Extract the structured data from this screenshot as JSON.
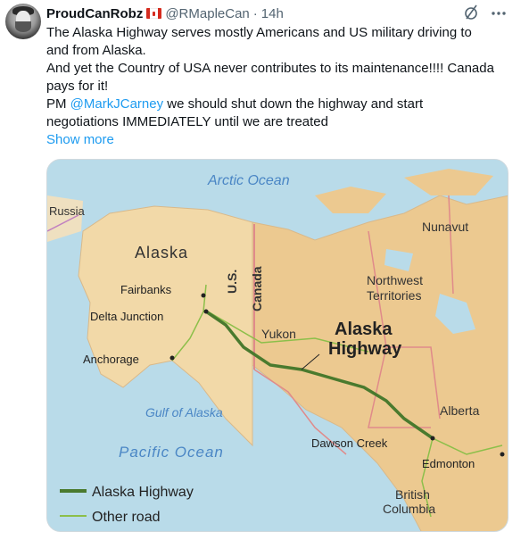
{
  "author": {
    "display_name": "ProudCanRobz",
    "handle": "@RMapleCan",
    "separator": "·",
    "timestamp": "14h"
  },
  "icons": {
    "avatar": "avatar-photo",
    "flag": "canada-flag-emoji",
    "grok": "grok-icon",
    "more": "more-options-icon"
  },
  "tweet": {
    "lines": [
      "The Alaska Highway serves mostly Americans and US military driving to",
      "and from Alaska.",
      "And yet the Country of USA never contributes to its maintenance!!!! Canada",
      "pays for it!"
    ],
    "pm_prefix": "PM ",
    "mention": "@MarkJCarney",
    "pm_suffix": " we should shut down the highway and start",
    "last_line": "negotiations IMMEDIATELY until we are treated",
    "show_more": "Show more"
  },
  "map": {
    "arctic_ocean": "Arctic Ocean",
    "russia": "Russia",
    "nunavut": "Nunavut",
    "alaska": "Alaska",
    "us": "U.S.",
    "canada": "Canada",
    "northwest_territories_1": "Northwest",
    "northwest_territories_2": "Territories",
    "fairbanks": "Fairbanks",
    "delta_junction": "Delta Junction",
    "yukon": "Yukon",
    "title_1": "Alaska",
    "title_2": "Highway",
    "anchorage": "Anchorage",
    "gulf_of_alaska": "Gulf of Alaska",
    "alberta": "Alberta",
    "dawson_creek": "Dawson Creek",
    "pacific_ocean": "Pacific Ocean",
    "edmonton": "Edmonton",
    "british_columbia_1": "British",
    "british_columbia_2": "Columbia",
    "legend_highway": "Alaska Highway",
    "legend_other": "Other road",
    "colors": {
      "water": "#b9dbe9",
      "land_alaska": "#f2d9a8",
      "land_canada": "#ecc990",
      "highway": "#4a7a2e",
      "other_road": "#8cbf4a",
      "border": "#e08a8a"
    }
  }
}
